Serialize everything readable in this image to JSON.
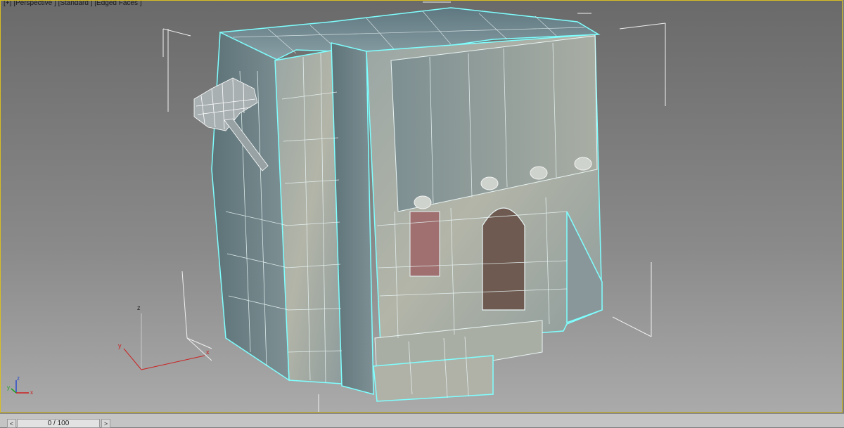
{
  "viewport": {
    "label_plus": "[+]",
    "label_view": "[Perspective ]",
    "label_shading": "[Standard ]",
    "label_mode": "[Edged Faces ]",
    "axis_x": "x",
    "axis_y": "y",
    "axis_z": "z",
    "selection_color": "#7fffff",
    "border_color": "#d8c020"
  },
  "timeline": {
    "left_arrow": "<",
    "right_arrow": ">",
    "frame_display": "0 / 100"
  }
}
